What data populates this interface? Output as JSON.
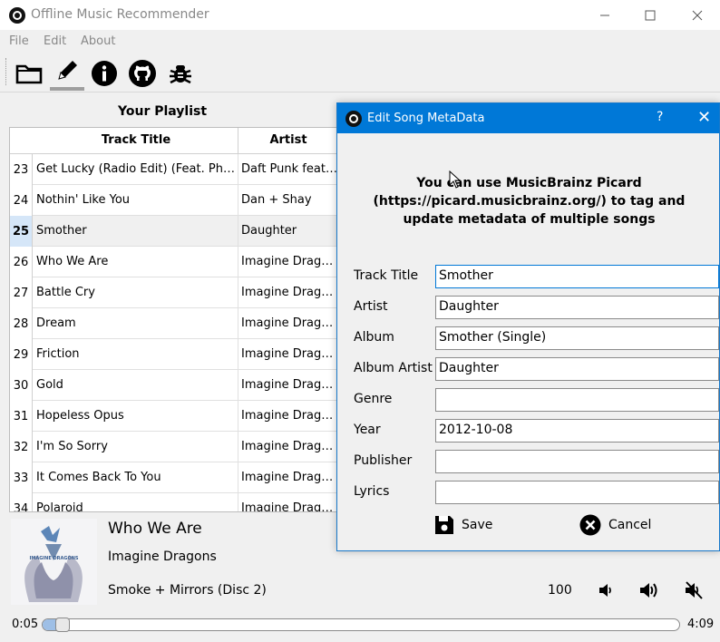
{
  "window": {
    "title": "Offline Music Recommender",
    "controls": [
      "minimize",
      "maximize",
      "close"
    ]
  },
  "menu": {
    "items": [
      "File",
      "Edit",
      "About"
    ]
  },
  "toolbar": {
    "buttons": [
      {
        "icon": "folder-icon",
        "active": false
      },
      {
        "icon": "edit-pencil-icon",
        "active": true
      },
      {
        "icon": "info-icon",
        "active": false
      },
      {
        "icon": "github-icon",
        "active": false
      },
      {
        "icon": "bug-icon",
        "active": false
      }
    ]
  },
  "playlist": {
    "title": "Your Playlist",
    "columns": [
      "Track Title",
      "Artist"
    ],
    "selected_row": "25",
    "rows": [
      {
        "num": "23",
        "title": "Get Lucky (Radio Edit) (Feat. Pharrell Williams)",
        "artist": "Daft Punk feat. Pharrell Williams"
      },
      {
        "num": "24",
        "title": "Nothin' Like You",
        "artist": "Dan + Shay"
      },
      {
        "num": "25",
        "title": "Smother",
        "artist": "Daughter"
      },
      {
        "num": "26",
        "title": "Who We Are",
        "artist": "Imagine Dragons"
      },
      {
        "num": "27",
        "title": "Battle Cry",
        "artist": "Imagine Dragons"
      },
      {
        "num": "28",
        "title": "Dream",
        "artist": "Imagine Dragons"
      },
      {
        "num": "29",
        "title": "Friction",
        "artist": "Imagine Dragons"
      },
      {
        "num": "30",
        "title": "Gold",
        "artist": "Imagine Dragons"
      },
      {
        "num": "31",
        "title": "Hopeless Opus",
        "artist": "Imagine Dragons"
      },
      {
        "num": "32",
        "title": "I'm So Sorry",
        "artist": "Imagine Dragons"
      },
      {
        "num": "33",
        "title": "It Comes Back To You",
        "artist": "Imagine Dragons"
      },
      {
        "num": "34",
        "title": "Polaroid",
        "artist": "Imagine Dragons"
      }
    ]
  },
  "now_playing": {
    "title": "Who We Are",
    "artist": "Imagine Dragons",
    "album": "Smoke + Mirrors (Disc 2)",
    "cover_text": "IMAGINE DRAGONS",
    "volume": "100",
    "current_time": "0:05",
    "total_time": "4:09",
    "progress_fraction": 0.02
  },
  "dialog": {
    "title": "Edit Song MetaData",
    "help": "?",
    "close": "✕",
    "message": "You can use  MusicBrainz Picard (https://picard.musicbrainz.org/) to tag and update metadata of multiple songs",
    "fields": [
      {
        "label": "Track Title",
        "value": "Smother",
        "focused": true
      },
      {
        "label": "Artist",
        "value": "Daughter"
      },
      {
        "label": "Album",
        "value": "Smother (Single)"
      },
      {
        "label": "Album Artist",
        "value": "Daughter"
      },
      {
        "label": "Genre",
        "value": ""
      },
      {
        "label": "Year",
        "value": "2012-10-08"
      },
      {
        "label": "Publisher",
        "value": ""
      },
      {
        "label": "Lyrics",
        "value": ""
      }
    ],
    "save_label": "Save",
    "cancel_label": "Cancel"
  },
  "colors": {
    "dialog_titlebar": "#0078d7",
    "selected_rownum": "#d5e6f8",
    "seek_fill": "#9ebfe6"
  }
}
